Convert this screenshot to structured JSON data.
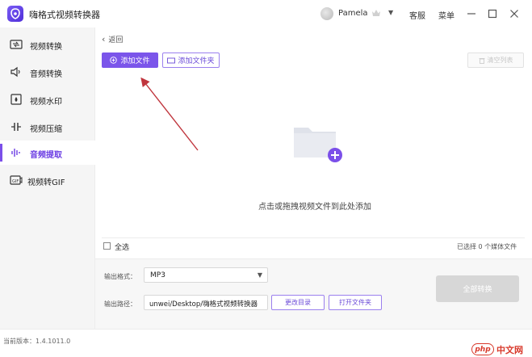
{
  "app": {
    "title": "嗨格式视频转换器"
  },
  "user": {
    "name": "Pamela"
  },
  "titlebar": {
    "service": "客服",
    "menu": "菜单"
  },
  "sidebar": {
    "items": [
      {
        "label": "视频转换",
        "icon": "video-convert-icon",
        "active": false
      },
      {
        "label": "音频转换",
        "icon": "speaker-icon",
        "active": false
      },
      {
        "label": "视频水印",
        "icon": "watermark-icon",
        "active": false
      },
      {
        "label": "视频压缩",
        "icon": "compress-icon",
        "active": false
      },
      {
        "label": "音频提取",
        "icon": "audio-wave-icon",
        "active": true
      },
      {
        "label": "视频转GIF",
        "icon": "gif-icon",
        "active": false
      }
    ]
  },
  "main": {
    "back_label": "返回",
    "add_file_label": "添加文件",
    "add_folder_label": "添加文件夹",
    "clear_label": "清空列表",
    "drop_hint": "点击或拖拽视频文件到此处添加",
    "select_all_label": "全选",
    "selected_count_text": "已选择 0 个媒体文件"
  },
  "settings": {
    "format_label": "输出格式：",
    "format_value": "MP3",
    "path_label": "输出路径：",
    "path_value": "unwei/Desktop/嗨格式视频转换器",
    "change_dir_label": "更改目录",
    "open_folder_label": "打开文件夹",
    "convert_all_label": "全部转换"
  },
  "status": {
    "version_text": "当前版本：1.4.1011.0"
  },
  "watermark": {
    "badge": "php",
    "text": "中文网"
  },
  "colors": {
    "accent": "#7b55ea",
    "annotation_arrow": "#c0353d"
  }
}
